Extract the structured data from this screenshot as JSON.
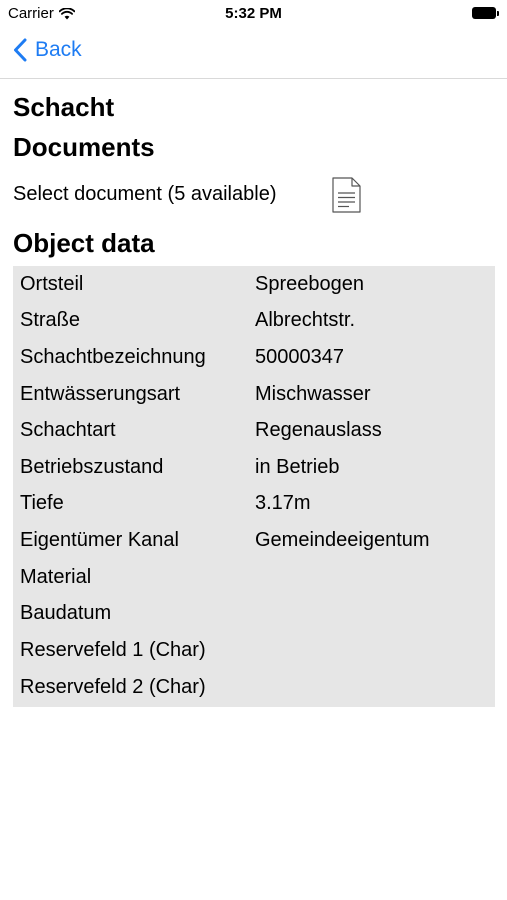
{
  "status_bar": {
    "carrier": "Carrier",
    "time": "5:32 PM",
    "wifi_icon": "wifi-icon",
    "battery_icon": "battery-icon"
  },
  "nav": {
    "back_label": "Back",
    "back_icon": "chevron-left-icon",
    "accent_color": "#1e7cf3"
  },
  "page": {
    "title": "Schacht",
    "documents_title": "Documents",
    "select_document_label": "Select document (5 available)",
    "document_icon": "document-icon",
    "object_data_title": "Object data",
    "table_background": "#e6e6e6"
  },
  "object_data": [
    {
      "label": "Ortsteil",
      "value": "Spreebogen"
    },
    {
      "label": "Straße",
      "value": "Albrechtstr."
    },
    {
      "label": "Schachtbezeichnung",
      "value": "50000347"
    },
    {
      "label": "Entwässerungsart",
      "value": "Mischwasser"
    },
    {
      "label": "Schachtart",
      "value": "Regenauslass"
    },
    {
      "label": "Betriebszustand",
      "value": "in Betrieb"
    },
    {
      "label": "Tiefe",
      "value": "3.17m"
    },
    {
      "label": "Eigentümer Kanal",
      "value": "Gemeindeeigentum"
    },
    {
      "label": "Material",
      "value": ""
    },
    {
      "label": "Baudatum",
      "value": ""
    },
    {
      "label": "Reservefeld 1 (Char)",
      "value": ""
    },
    {
      "label": "Reservefeld 2 (Char)",
      "value": ""
    }
  ]
}
